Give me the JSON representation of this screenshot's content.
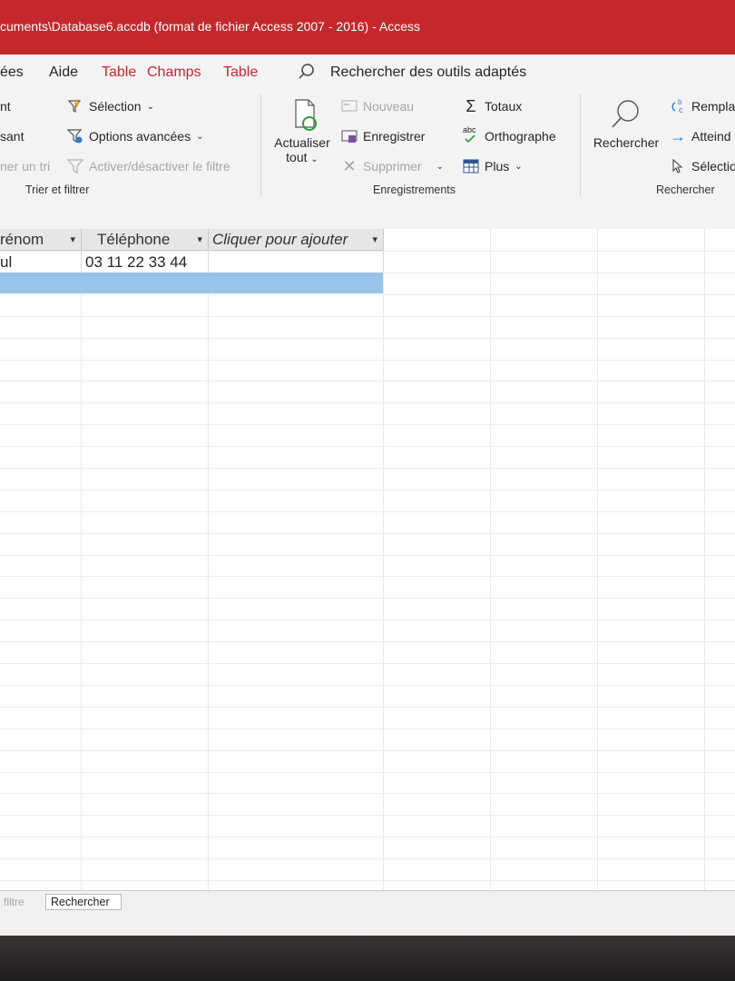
{
  "window": {
    "title": "cuments\\Database6.accdb (format de fichier Access 2007 - 2016)  -  Access"
  },
  "tabs": {
    "partial_data": "ées",
    "help": "Aide",
    "table_fields_1": "Table",
    "table_fields_2": "Champs",
    "table": "Table",
    "search_tools": "Rechercher des outils adaptés"
  },
  "ribbon": {
    "sort_filter": {
      "ascending_partial": "nt",
      "descending_partial": "sant",
      "remove_sort_partial": "ner un tri",
      "selection": "Sélection",
      "advanced": "Options avancées",
      "toggle_filter": "Activer/désactiver le filtre",
      "group_label": "Trier et filtrer"
    },
    "records": {
      "refresh_line1": "Actualiser",
      "refresh_line2": "tout",
      "new": "Nouveau",
      "save": "Enregistrer",
      "delete": "Supprimer",
      "totals": "Totaux",
      "spelling": "Orthographe",
      "more": "Plus",
      "abc": "abc",
      "group_label": "Enregistrements"
    },
    "find": {
      "find": "Rechercher",
      "replace_partial": "Rempla",
      "goto_partial": "Atteind",
      "select_partial": "Sélectio",
      "group_label": "Rechercher"
    }
  },
  "datasheet": {
    "columns": [
      "rénom",
      "Téléphone",
      "Cliquer pour ajouter"
    ],
    "rows": [
      [
        "ul",
        "03 11 22 33 44",
        ""
      ]
    ]
  },
  "status": {
    "filter_partial": "filtre",
    "search_box": "Rechercher"
  },
  "colors": {
    "title_bar": "#c4282d",
    "selected_row": "#99c3e8",
    "tab_accent": "#c4282d"
  }
}
